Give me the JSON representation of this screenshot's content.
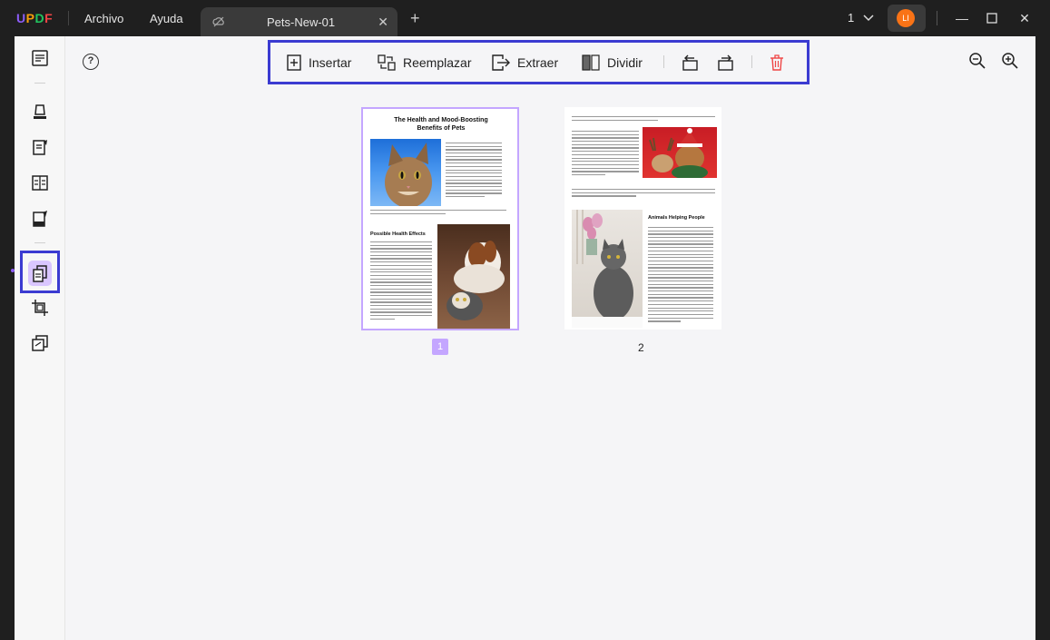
{
  "app": {
    "logo": "UPDF",
    "menu": [
      "Archivo",
      "Ayuda"
    ]
  },
  "tab": {
    "title": "Pets-New-01"
  },
  "header": {
    "page_count": "1",
    "avatar_initial": "LI"
  },
  "toolbar": {
    "insert_label": "Insertar",
    "replace_label": "Reemplazar",
    "extract_label": "Extraer",
    "split_label": "Dividir"
  },
  "sidebar": {
    "items": [
      "reader-icon",
      "comment-icon",
      "edit-icon",
      "form-icon",
      "sign-icon",
      "organize-pages-icon",
      "crop-icon",
      "layers-icon"
    ],
    "active": "organize-pages-icon"
  },
  "pages": [
    {
      "number": "1",
      "selected": true,
      "title": "The Health and Mood-Boosting Benefits of Pets",
      "heading": "Possible Health Effects"
    },
    {
      "number": "2",
      "selected": false,
      "heading": "Animals Helping People"
    }
  ],
  "colors": {
    "accent": "#8b5cf6",
    "highlight_border": "#3b3bd1",
    "selected_page": "#c4a6ff",
    "delete": "#ef4444"
  }
}
